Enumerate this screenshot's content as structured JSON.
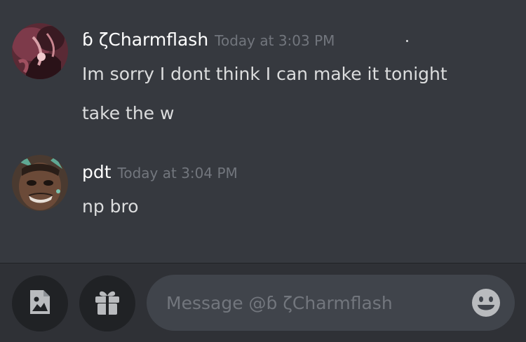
{
  "conversation": {
    "messages": [
      {
        "author": "ɓ ζCharmflash",
        "timestamp": "Today at 3:03 PM",
        "lines": [
          "Im sorry I dont think I can make it tonight",
          "take the w"
        ]
      },
      {
        "author": "pdt",
        "timestamp": "Today at 3:04 PM",
        "lines": [
          "np bro"
        ]
      }
    ]
  },
  "composer": {
    "placeholder": "Message @ɓ ζCharmflash",
    "buttons": {
      "attach": "image-icon",
      "gift": "gift-icon",
      "emoji": "emoji-icon"
    }
  },
  "colors": {
    "background": "#36393f",
    "composer_background": "#2f3136",
    "input_background": "#40444b",
    "username": "#ffffff",
    "message_text": "#dcddde",
    "timestamp": "#72767d",
    "icon": "#b9bbbe"
  }
}
